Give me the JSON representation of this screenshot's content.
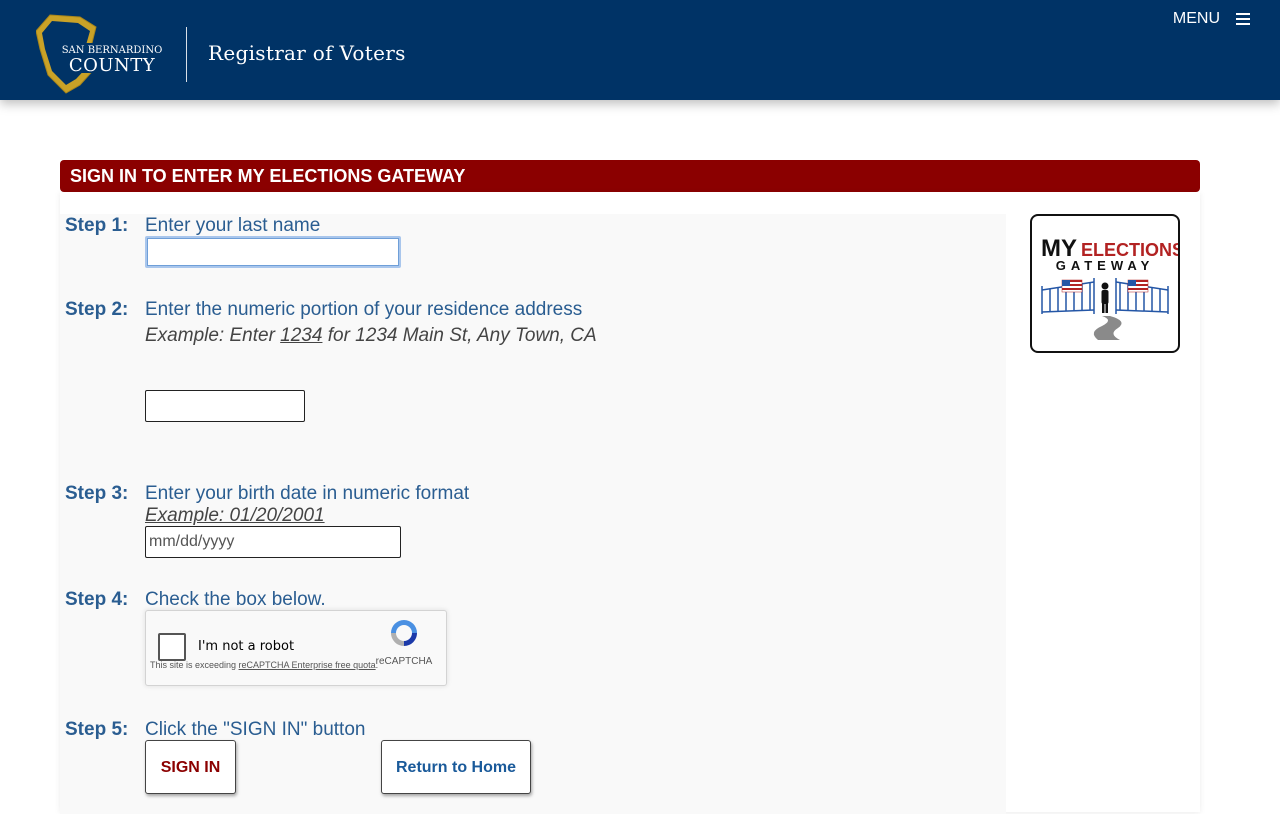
{
  "header": {
    "logo_line1": "SAN BERNARDINO",
    "logo_line2": "COUNTY",
    "site_title": "Registrar of Voters",
    "menu_label": "MENU"
  },
  "banner": {
    "title": "SIGN IN TO ENTER MY ELECTIONS GATEWAY"
  },
  "steps": [
    {
      "label": "Step 1:",
      "text": "Enter your last name"
    },
    {
      "label": "Step 2:",
      "text": "Enter the numeric portion of your residence address",
      "example_prefix": "Example: Enter ",
      "example_number": "1234",
      "example_suffix": " for 1234 Main St, Any Town, CA"
    },
    {
      "label": "Step 3:",
      "text": "Enter your birth date in numeric format",
      "example": "Example: 01/20/2001"
    },
    {
      "label": "Step 4:",
      "text": "Check the box below."
    },
    {
      "label": "Step 5:",
      "text": "Click the \"SIGN IN\" button"
    }
  ],
  "inputs": {
    "last_name": {
      "value": "",
      "placeholder": ""
    },
    "address_number": {
      "value": "",
      "placeholder": ""
    },
    "birth_date": {
      "value": "",
      "placeholder": "mm/dd/yyyy"
    }
  },
  "captcha": {
    "label": "I'm not a robot",
    "brand": "reCAPTCHA",
    "warning_prefix": "This site is exceeding ",
    "warning_link": "reCAPTCHA Enterprise free quota",
    "warning_suffix": "."
  },
  "buttons": {
    "sign_in": "SIGN IN",
    "return_home": "Return to Home"
  },
  "gateway_logo": {
    "line1_my": "MY",
    "line1_elections": "ELECTIONS",
    "line2": "GATEWAY"
  },
  "colors": {
    "header_bg": "#003366",
    "banner_bg": "#8b0000",
    "step_text": "#2a5d91",
    "logo_gold": "#c9a227"
  },
  "icons": {
    "menu": "hamburger-icon",
    "captcha": "recaptcha-icon"
  }
}
